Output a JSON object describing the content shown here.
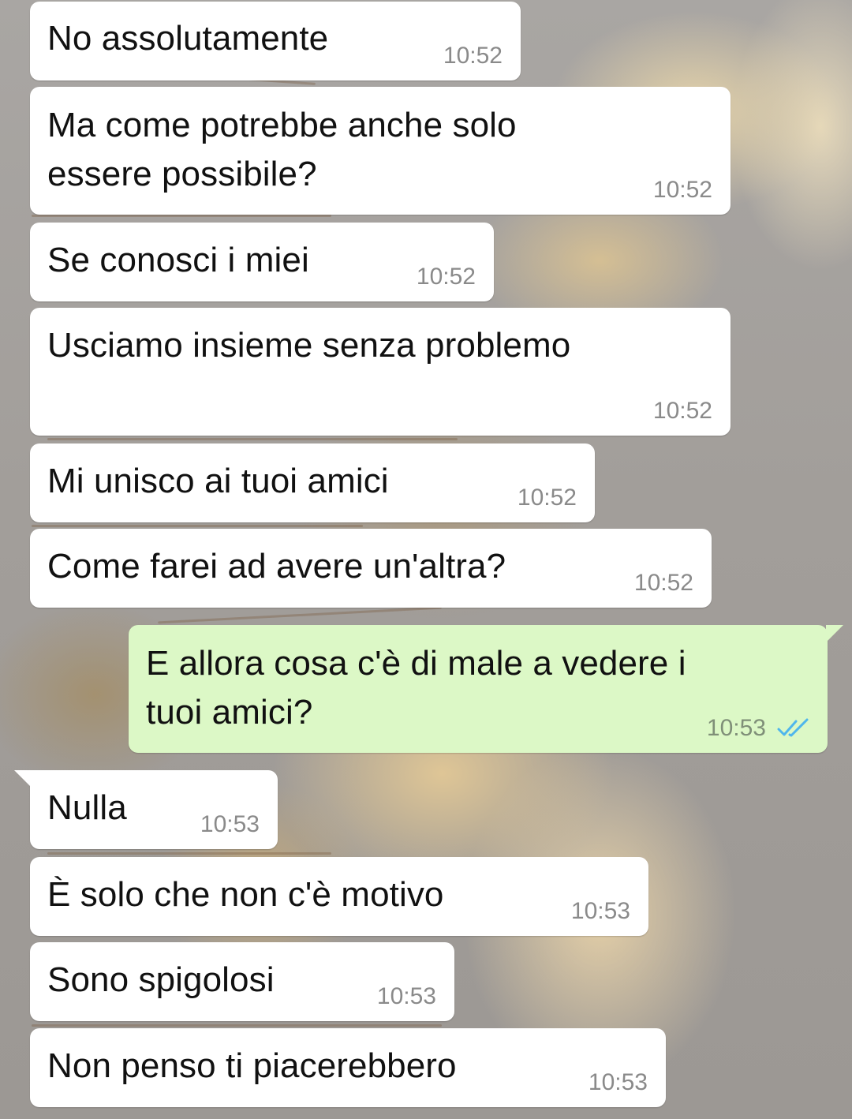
{
  "chat": {
    "messages": [
      {
        "direction": "incoming",
        "text": "No assolutamente",
        "time": "10:52"
      },
      {
        "direction": "incoming",
        "text": "Ma come potrebbe anche solo\nessere possibile?",
        "time": "10:52"
      },
      {
        "direction": "incoming",
        "text": "Se conosci i miei",
        "time": "10:52"
      },
      {
        "direction": "incoming",
        "text": "Usciamo insieme senza problemo",
        "time": "10:52"
      },
      {
        "direction": "incoming",
        "text": "Mi unisco ai tuoi amici",
        "time": "10:52"
      },
      {
        "direction": "incoming",
        "text": "Come farei ad avere un'altra?",
        "time": "10:52"
      },
      {
        "direction": "outgoing",
        "text": "E allora cosa c'è di male a vedere i\ntuoi amici?",
        "time": "10:53",
        "status": "read"
      },
      {
        "direction": "incoming",
        "text": "Nulla",
        "time": "10:53"
      },
      {
        "direction": "incoming",
        "text": "È solo che non c'è motivo",
        "time": "10:53"
      },
      {
        "direction": "incoming",
        "text": "Sono spigolosi",
        "time": "10:53"
      },
      {
        "direction": "incoming",
        "text": "Non penso ti piacerebbero",
        "time": "10:53"
      }
    ]
  },
  "colors": {
    "incoming_bubble": "#ffffff",
    "outgoing_bubble": "#dcf8c6",
    "read_tick": "#4fb6ec",
    "timestamp": "#8a8a8a"
  },
  "icons": {
    "read_status": "double-check-icon"
  }
}
